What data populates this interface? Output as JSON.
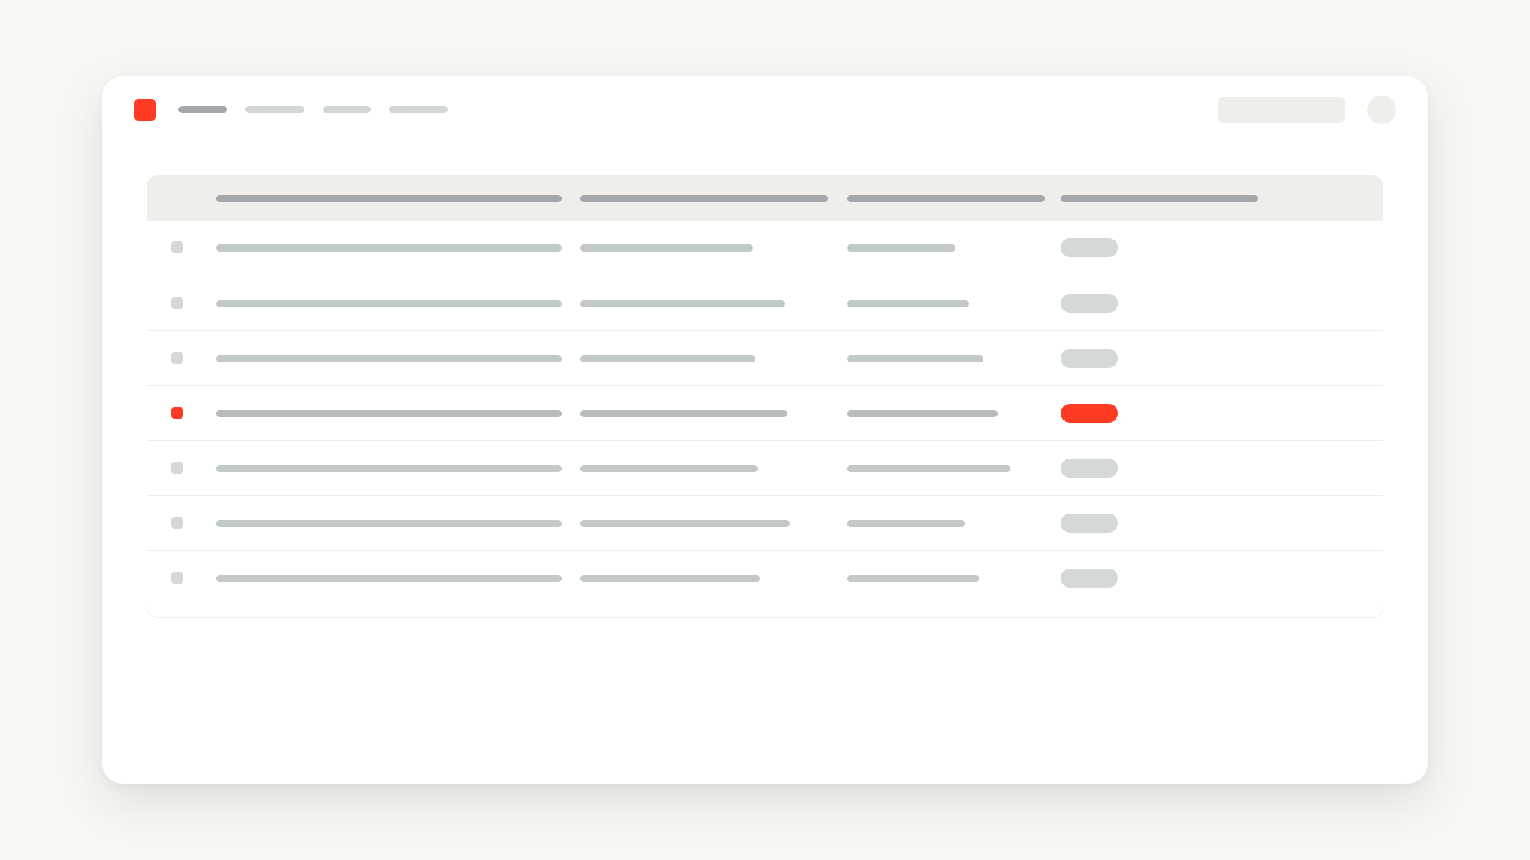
{
  "app": {
    "brand_color": "#ff3b23",
    "nav": {
      "items": [
        {
          "label": "",
          "active": true
        },
        {
          "label": "",
          "active": false
        },
        {
          "label": "",
          "active": false
        },
        {
          "label": "",
          "active": false
        }
      ]
    },
    "search": {
      "placeholder": "",
      "value": ""
    },
    "user": {
      "avatar": "avatar-circle-placeholder"
    }
  },
  "table": {
    "columns": [
      "",
      "",
      "",
      ""
    ],
    "rows": [
      {
        "cells": [
          "",
          "",
          ""
        ],
        "status": "",
        "highlighted": false
      },
      {
        "cells": [
          "",
          "",
          ""
        ],
        "status": "",
        "highlighted": false
      },
      {
        "cells": [
          "",
          "",
          ""
        ],
        "status": "",
        "highlighted": false
      },
      {
        "cells": [
          "",
          "",
          ""
        ],
        "status": "",
        "highlighted": true
      },
      {
        "cells": [
          "",
          "",
          ""
        ],
        "status": "",
        "highlighted": false
      },
      {
        "cells": [
          "",
          "",
          ""
        ],
        "status": "",
        "highlighted": false
      },
      {
        "cells": [
          "",
          "",
          ""
        ],
        "status": "",
        "highlighted": false
      }
    ]
  },
  "colors": {
    "background": "#f8f7f3",
    "surface": "#ffffff",
    "accent": "#ff3b23",
    "header_background": "#efeeea",
    "skeleton_dark": "#a4a8aa",
    "skeleton_mid": "#b7bcbd",
    "skeleton_light": "#c3c8c8",
    "chip": "#d5d8d8",
    "search_field": "#efeeea",
    "avatar": "#efeeea",
    "divider": "#eeede9"
  }
}
